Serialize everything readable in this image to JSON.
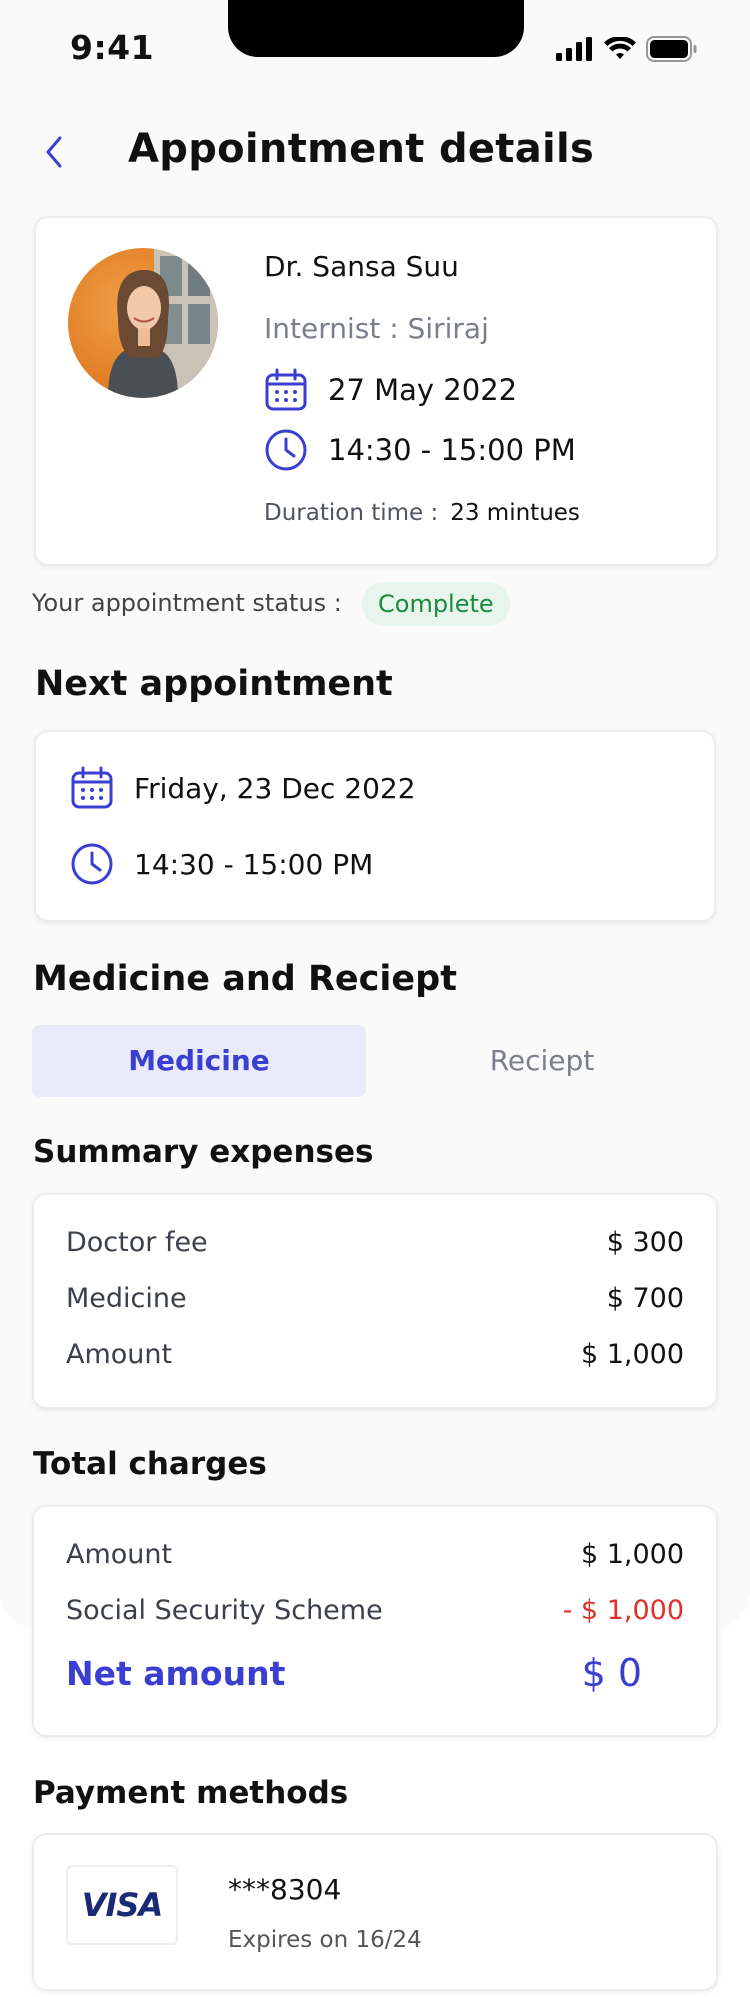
{
  "status_bar": {
    "time": "9:41"
  },
  "header": {
    "title": "Appointment details"
  },
  "doctor": {
    "name": "Dr. Sansa Suu",
    "specialty": "Internist : Siriraj",
    "date": "27 May 2022",
    "time": "14:30 - 15:00 PM",
    "duration_label": "Duration time :",
    "duration_value": "23 mintues"
  },
  "status": {
    "label": "Your appointment status :",
    "value": "Complete"
  },
  "next_appointment": {
    "heading": "Next appointment",
    "date": "Friday, 23 Dec 2022",
    "time": "14:30 - 15:00 PM"
  },
  "medicine_section": {
    "heading": "Medicine and Reciept",
    "tabs": [
      {
        "label": "Medicine",
        "active": true
      },
      {
        "label": "Reciept",
        "active": false
      }
    ]
  },
  "summary": {
    "heading": "Summary expenses",
    "rows": [
      {
        "label": "Doctor fee",
        "value": "$ 300"
      },
      {
        "label": "Medicine",
        "value": "$ 700"
      },
      {
        "label": "Amount",
        "value": "$ 1,000"
      }
    ]
  },
  "total": {
    "heading": "Total charges",
    "rows": [
      {
        "label": "Amount",
        "value": "$ 1,000"
      },
      {
        "label": "Social Security Scheme",
        "value": "- $ 1,000"
      }
    ],
    "net_label": "Net amount",
    "net_value": "$ 0"
  },
  "payment": {
    "heading": "Payment methods",
    "brand": "VISA",
    "card_number": "***8304",
    "expiry": "Expires on 16/24"
  },
  "colors": {
    "accent": "#3a3fd1",
    "success_bg": "#e7f5ec",
    "success_text": "#1b8a3e",
    "negative": "#e0302a",
    "tab_active_bg": "#e9ebfb"
  },
  "icons": [
    "back-chevron-icon",
    "calendar-icon",
    "clock-icon",
    "signal-icon",
    "wifi-icon",
    "battery-icon"
  ]
}
